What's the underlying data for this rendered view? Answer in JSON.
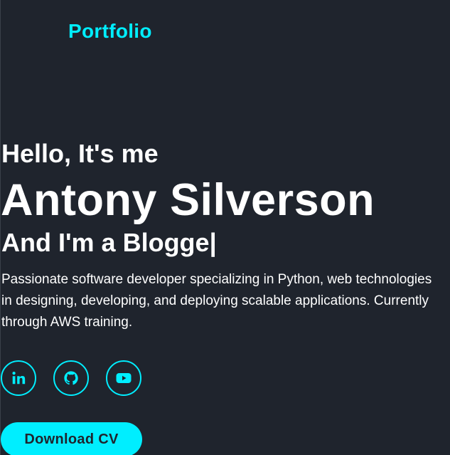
{
  "header": {
    "logo": "Portfolio"
  },
  "hero": {
    "greeting": "Hello, It's me",
    "name": "Antony Silverson",
    "role_text": "And I'm a Blogge|",
    "description_lines": [
      "Passionate software developer specializing in Python, web technologies",
      "in designing, developing, and deploying scalable applications. Currently",
      "through AWS training."
    ]
  },
  "social": {
    "items": [
      {
        "icon": "linkedin-icon",
        "label": "in"
      },
      {
        "icon": "github-icon"
      },
      {
        "icon": "youtube-icon"
      }
    ]
  },
  "actions": {
    "download_cv": "Download CV"
  },
  "colors": {
    "background": "#1f242d",
    "accent": "#00eeff",
    "text": "#ffffff"
  }
}
